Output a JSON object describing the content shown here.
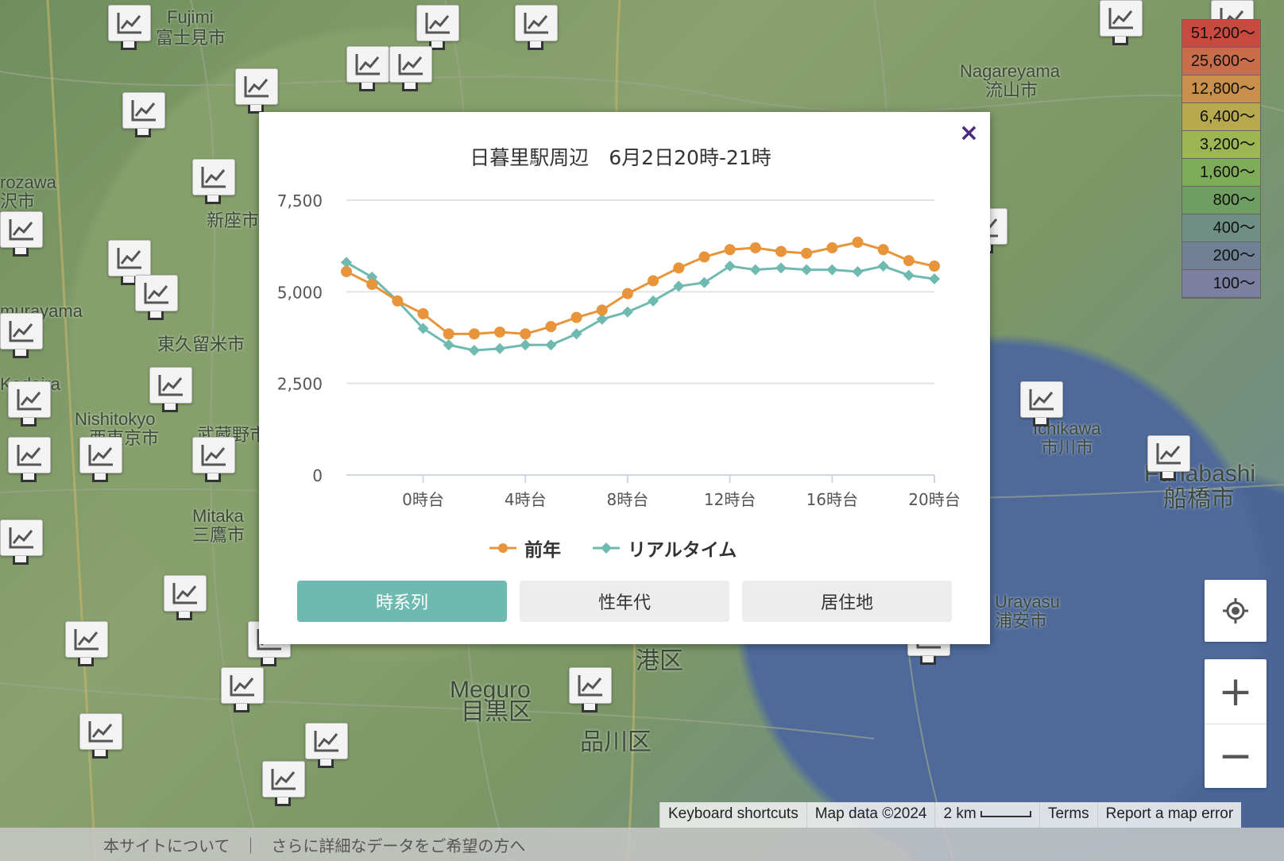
{
  "map": {
    "places": [
      {
        "name": "Fujimi",
        "x": 210,
        "y": 10
      },
      {
        "name": "富士見市",
        "x": 196,
        "y": 36
      },
      {
        "name": "Nagareyama",
        "x": 1208,
        "y": 78
      },
      {
        "name": "流山市",
        "x": 1240,
        "y": 102
      },
      {
        "name": "rozawa",
        "x": 0,
        "y": 218
      },
      {
        "name": "沢市",
        "x": 0,
        "y": 242
      },
      {
        "name": "新座市",
        "x": 260,
        "y": 266
      },
      {
        "name": "murayama",
        "x": 0,
        "y": 380
      },
      {
        "name": "東久留米市",
        "x": 198,
        "y": 422
      },
      {
        "name": "Kodaira",
        "x": 0,
        "y": 472
      },
      {
        "name": "Nishitokyo",
        "x": 94,
        "y": 516
      },
      {
        "name": "西東京市",
        "x": 112,
        "y": 540
      },
      {
        "name": "武蔵野市",
        "x": 248,
        "y": 536
      },
      {
        "name": "Mitaka",
        "x": 242,
        "y": 638
      },
      {
        "name": "三鷹市",
        "x": 242,
        "y": 662
      },
      {
        "name": "Ichikawa",
        "x": 1300,
        "y": 528
      },
      {
        "name": "市川市",
        "x": 1310,
        "y": 552
      },
      {
        "name": "Funabashi",
        "x": 1440,
        "y": 580
      },
      {
        "name": "船橋市",
        "x": 1464,
        "y": 612
      },
      {
        "name": "Meguro",
        "x": 566,
        "y": 852
      },
      {
        "name": "目黒区",
        "x": 580,
        "y": 880
      },
      {
        "name": "港区",
        "x": 800,
        "y": 816
      },
      {
        "name": "品川区",
        "x": 730,
        "y": 918
      },
      {
        "name": "Urayasu",
        "x": 1252,
        "y": 746
      },
      {
        "name": "浦安市",
        "x": 1252,
        "y": 770
      }
    ],
    "legend": [
      "51,200〜",
      "25,600〜",
      "12,800〜",
      "6,400〜",
      "3,200〜",
      "1,600〜",
      "800〜",
      "400〜",
      "200〜",
      "100〜"
    ],
    "legend_colors": [
      "#c84a3e",
      "#c86c4a",
      "#c8904a",
      "#b8a84e",
      "#9db552",
      "#7fac58",
      "#6e9e62",
      "#6f8f84",
      "#708196",
      "#7c7fa0"
    ],
    "attribution": {
      "keyboard": "Keyboard shortcuts",
      "mapdata": "Map data ©2024",
      "scale": "2 km",
      "terms": "Terms",
      "report": "Report a map error"
    },
    "zoom_in": "+",
    "zoom_out": "−"
  },
  "footer": {
    "about": "本サイトについて",
    "sep": "｜",
    "more": "さらに詳細なデータをご希望の方へ"
  },
  "modal": {
    "title": "日暮里駅周辺　6月2日20時-21時",
    "close": "×",
    "tabs": [
      "時系列",
      "性年代",
      "居住地"
    ],
    "active_tab": 0
  },
  "chart_data": {
    "type": "line",
    "yticks": [
      "0",
      "2,500",
      "5,000",
      "7,500"
    ],
    "ylim": [
      0,
      7500
    ],
    "xticks": [
      "0時台",
      "4時台",
      "8時台",
      "12時台",
      "16時台",
      "20時台"
    ],
    "x": [
      "21時台",
      "22時台",
      "23時台",
      "0時台",
      "1時台",
      "2時台",
      "3時台",
      "4時台",
      "5時台",
      "6時台",
      "7時台",
      "8時台",
      "9時台",
      "10時台",
      "11時台",
      "12時台",
      "13時台",
      "14時台",
      "15時台",
      "16時台",
      "17時台",
      "18時台",
      "19時台",
      "20時台"
    ],
    "series": [
      {
        "name": "前年",
        "color": "#e8943a",
        "marker": "circle",
        "values": [
          5550,
          5200,
          4750,
          4400,
          3850,
          3850,
          3900,
          3850,
          4050,
          4300,
          4500,
          4950,
          5300,
          5650,
          5950,
          6150,
          6200,
          6100,
          6050,
          6200,
          6350,
          6150,
          5850,
          5700
        ]
      },
      {
        "name": "リアルタイム",
        "color": "#6ebab0",
        "marker": "diamond",
        "values": [
          5800,
          5400,
          4750,
          4000,
          3550,
          3400,
          3450,
          3550,
          3550,
          3850,
          4250,
          4450,
          4750,
          5150,
          5250,
          5700,
          5600,
          5650,
          5600,
          5600,
          5550,
          5700,
          5450,
          5350
        ]
      }
    ]
  }
}
